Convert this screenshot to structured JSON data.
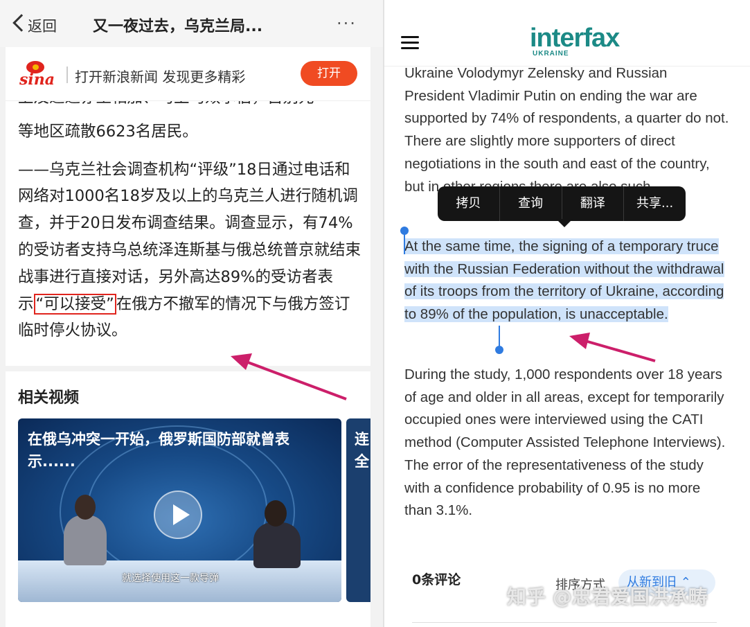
{
  "left": {
    "nav": {
      "back_label": "返回",
      "title": "又一夜过去，乌克兰局...",
      "more": "···"
    },
    "banner": {
      "logo_text": "sina",
      "text": "打开新浪新闻 发现更多精彩",
      "open_button": "打开"
    },
    "article": {
      "cut_line": "上及迄迄亦王相加、马上马效尔伯，古别元",
      "p1": "等地区疏散6623名居民。",
      "p2_before": "——乌克兰社会调查机构“评级”18日通过电话和网络对1000名18岁及以上的乌克兰人进行随机调查，并于20日发布调查结果。调查显示，有74%的受访者支持乌总统泽连斯基与俄总统普京就结束战事进行直接对话，另外高达89%的受访者表示",
      "p2_highlight": "“可以接受”",
      "p2_after": "在俄方不撤军的情况下与俄方签订临时停火协议。"
    },
    "related": {
      "title": "相关视频",
      "video_title": "在俄乌冲突一开始，俄罗斯国防部就曾表示......",
      "video_subtitle": "就选择使用这一款导弹",
      "video2_title": "连全"
    }
  },
  "right": {
    "logo": "interfax",
    "logo_sub": "UKRAINE",
    "p1": "Ukraine Volodymyr Zelensky and Russian President Vladimir Putin on ending the war are supported by 74% of respondents, a quarter do not. There are slightly more supporters of direct negotiations in the south and east of the country, but in other regions there are also such",
    "p2": "At the same time, the signing of a temporary truce with the Russian Federation without the withdrawal of its troops from the territory of Ukraine, according to 89% of the population, is unacceptable.",
    "p3": "During the study, 1,000 respondents over 18 years of age and older in all areas, except for temporarily occupied ones were interviewed using the CATI method (Computer Assisted Telephone Interviews). The error of the representativeness of the study with a confidence probability of 0.95 is no more than 3.1%.",
    "context_menu": [
      "拷贝",
      "查询",
      "翻译",
      "共享..."
    ],
    "comments_label": "0条评论",
    "sort_label": "排序方式",
    "sort_value": "从新到旧 ⌃"
  },
  "annotation_color": "#cc1f6a",
  "highlight_color": "#cfe3fa",
  "watermark": "知乎 @忠君爱国洪承畴"
}
